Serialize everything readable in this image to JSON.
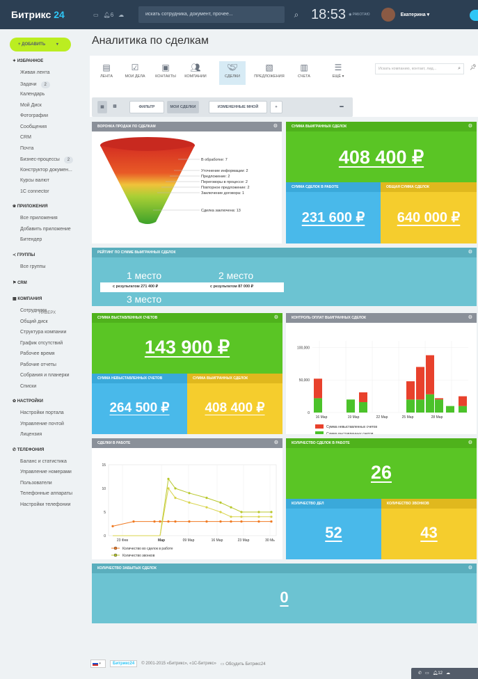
{
  "topbar": {
    "brand_a": "Битрикс",
    "brand_b": "24",
    "notif_count": "6",
    "search_placeholder": "искать сотрудника, документ, прочее...",
    "clock": "18:53",
    "status": "РАБОТАЮ",
    "user": "Екатерина"
  },
  "sidebar": {
    "add_button": "+ ДОБАВИТЬ",
    "favorites": "ИЗБРАННОЕ",
    "favorites_items": [
      {
        "label": "Живая лента"
      },
      {
        "label": "Задачи",
        "badge": "2"
      },
      {
        "label": "Календарь"
      },
      {
        "label": "Мой Диск"
      },
      {
        "label": "Фотографии"
      },
      {
        "label": "Сообщения"
      },
      {
        "label": "CRM"
      },
      {
        "label": "Почта"
      },
      {
        "label": "Бизнес-процессы",
        "badge": "2"
      },
      {
        "label": "Конструктор докумен..."
      },
      {
        "label": "Курсы валют"
      },
      {
        "label": "1С connector"
      }
    ],
    "apps": "ПРИЛОЖЕНИЯ",
    "apps_items": [
      "Все приложения",
      "Добавить приложение",
      "Битендер"
    ],
    "groups": "ГРУППЫ",
    "groups_items": [
      "Все группы"
    ],
    "up_label": "НАВЕРХ",
    "crm": "CRM",
    "company": "КОМПАНИЯ",
    "company_items": [
      "Сотрудники",
      "Общий диск",
      "Структура компании",
      "График отсутствий",
      "Рабочее время",
      "Рабочие отчеты",
      "Собрания и планерки",
      "Списки"
    ],
    "settings": "НАСТРОЙКИ",
    "settings_items": [
      "Настройки портала",
      "Управление почтой",
      "Лицензия"
    ],
    "telephony": "ТЕЛЕФОНИЯ",
    "telephony_items": [
      "Баланс и статистика",
      "Управление номерами",
      "Пользователи",
      "Телефонные аппараты",
      "Настройки телефонии"
    ]
  },
  "main": {
    "title": "Аналитика по сделкам",
    "nav": [
      "ЛЕНТА",
      "МОИ ДЕЛА",
      "КОНТАКТЫ",
      "КОМПАНИИ",
      "СДЕЛКИ",
      "ПРЕДЛОЖЕНИЯ",
      "СЧЕТА",
      "ЕЩЁ ▾"
    ],
    "nav_search_placeholder": "Искать компанию, контакт, лид...",
    "toolbar": {
      "filter": "ФИЛЬТР",
      "my_deals": "МОИ СДЕЛКИ",
      "changed_by_me": "ИЗМЕНЕННЫЕ МНОЙ",
      "add": "+"
    }
  },
  "widgets": {
    "funnel": {
      "title": "ВОРОНКА ПРОДАЖ ПО СДЕЛКАМ",
      "labels": [
        "В обработке: 7",
        "Уточнение информации: 2",
        "Предложение: 2",
        "Переговоры в процессе: 2",
        "Повторное предложение: 2",
        "Заключение договора: 1",
        "Сделка заключена: 13"
      ]
    },
    "won_sum": {
      "title": "СУММА ВЫИГРАННЫХ СДЕЛОК",
      "value": "408 400 ₽"
    },
    "in_work_sum": {
      "title": "СУММА СДЕЛОК В РАБОТЕ",
      "value": "231 600 ₽"
    },
    "total_sum": {
      "title": "ОБЩАЯ СУММА СДЕЛОК",
      "value": "640 000 ₽"
    },
    "rating": {
      "title": "РЕЙТИНГ ПО СУММЕ ВЫИГРАННЫХ СДЕЛОК",
      "first": "1 место",
      "first_result": "с результатом 271 400 ₽",
      "second": "2 место",
      "second_result": "с результатом 87 000 ₽",
      "third": "3 место"
    },
    "invoiced": {
      "title": "СУММА ВЫСТАВЛЕННЫХ СЧЕТОВ",
      "value": "143 900 ₽"
    },
    "not_invoiced": {
      "title": "СУММА НЕВЫСТАВЛЕННЫХ СЧЕТОВ",
      "value": "264 500 ₽"
    },
    "won_sum2": {
      "title": "СУММА ВЫИГРАННЫХ СДЕЛОК",
      "value": "408 400 ₽"
    },
    "payments": {
      "title": "КОНТРОЛЬ ОПЛАТ ВЫИГРАННЫХ СДЕЛОК"
    },
    "deals_in_work": {
      "title": "СДЕЛКИ В РАБОТЕ"
    },
    "count_in_work": {
      "title": "КОЛИЧЕСТВО СДЕЛОК В РАБОТЕ",
      "value": "26"
    },
    "tasks": {
      "title": "КОЛИЧЕСТВО ДЕЛ",
      "value": "52"
    },
    "calls": {
      "title": "КОЛИЧЕСТВО ЗВОНКОВ",
      "value": "43"
    },
    "forgotten": {
      "title": "КОЛИЧЕСТВО ЗАБЫТЫХ СДЕЛОК",
      "value": "0"
    }
  },
  "chart_data": [
    {
      "type": "bar",
      "stacked": true,
      "title": "",
      "x_ticks": [
        "16 Мар",
        "19 Мар",
        "22 Мар",
        "25 Мар",
        "28 Мар"
      ],
      "y_ticks": [
        "0",
        "50,000",
        "100,000"
      ],
      "ylim": [
        0,
        110000
      ],
      "series": [
        {
          "name": "Сумма невыставленных счетов",
          "color": "#e8412c",
          "values": [
            30000,
            0,
            15000,
            0,
            28000,
            50000,
            60000,
            2000,
            0,
            15000
          ]
        },
        {
          "name": "Сумма выставленных счетов",
          "color": "#4bc22a",
          "values": [
            22000,
            20000,
            16000,
            0,
            20000,
            20000,
            28000,
            20000,
            10000,
            10000
          ]
        }
      ]
    },
    {
      "type": "line",
      "title": "",
      "x_ticks": [
        "23 Фев",
        "Мар",
        "09 Мар",
        "16 Мар",
        "23 Мар",
        "30 Мь"
      ],
      "y_ticks": [
        "0",
        "5",
        "10",
        "15"
      ],
      "ylim": [
        0,
        15
      ],
      "series": [
        {
          "name": "Количество во сделок в работе",
          "color": "#f07a22",
          "values": [
            2,
            3,
            3,
            3,
            3,
            3,
            3,
            3,
            3,
            3,
            3,
            3,
            3
          ]
        },
        {
          "name": "Количество звонков",
          "color": "#b8c72b",
          "values": [
            0,
            0,
            0,
            0,
            12,
            10,
            9,
            8,
            7,
            6,
            5,
            5,
            5
          ]
        },
        {
          "name": "Количество дел",
          "color": "#d8d34a",
          "values": [
            0,
            0,
            0,
            0,
            10,
            8,
            7,
            6,
            5,
            4,
            4,
            4,
            4
          ]
        }
      ]
    }
  ],
  "footer": {
    "copyright": "© 2001-2015 «Битрикс», «1С-Битрикс»",
    "discuss": "Обсудить Битрикс24",
    "badge": "Битрикс24",
    "corner_count": "12"
  }
}
